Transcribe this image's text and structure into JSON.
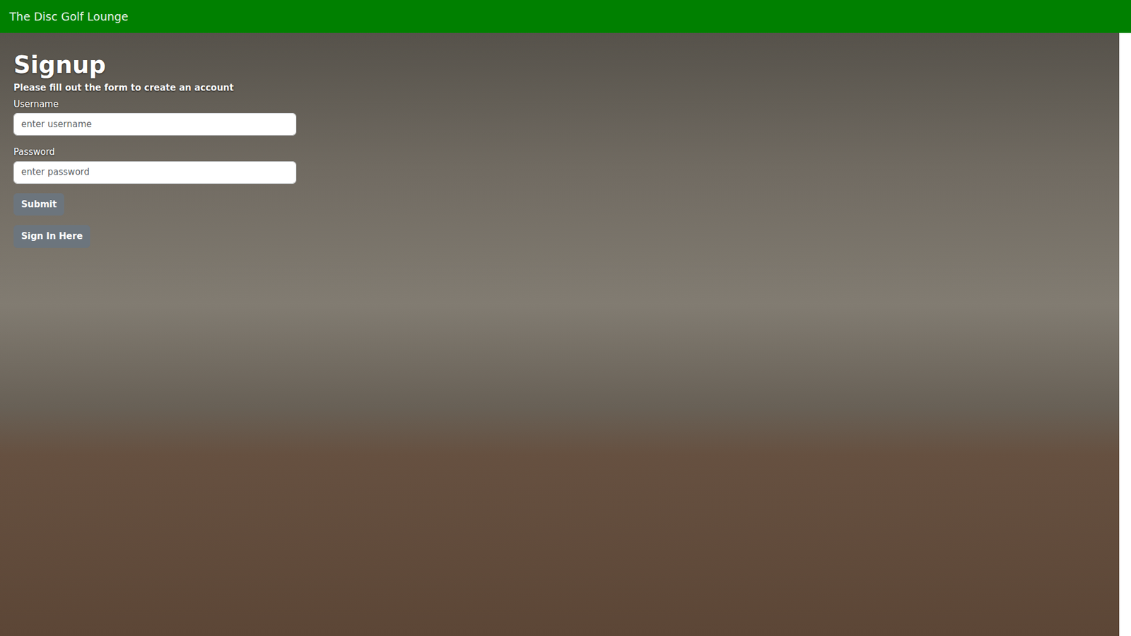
{
  "navbar": {
    "brand": "The Disc Golf Lounge"
  },
  "form": {
    "title": "Signup",
    "subtitle": "Please fill out the form to create an account",
    "fields": [
      {
        "label": "Username",
        "placeholder": "enter username",
        "kind": "text"
      },
      {
        "label": "Password",
        "placeholder": "enter password",
        "kind": "password"
      }
    ],
    "buttons": [
      "Submit",
      "Sign In Here"
    ]
  }
}
